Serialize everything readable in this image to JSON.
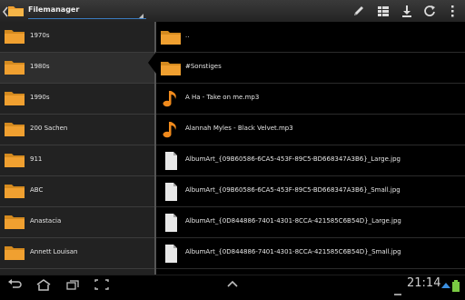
{
  "app": {
    "title": "Filemanager"
  },
  "toolbar": {
    "icons": [
      "edit-pencil-icon",
      "grid-view-icon",
      "download-icon",
      "refresh-icon",
      "overflow-menu-icon"
    ]
  },
  "left_pane": {
    "selected_index": 1,
    "items": [
      {
        "label": "1970s"
      },
      {
        "label": "1980s"
      },
      {
        "label": "1990s"
      },
      {
        "label": "200 Sachen"
      },
      {
        "label": "911"
      },
      {
        "label": "ABC"
      },
      {
        "label": "Anastacia"
      },
      {
        "label": "Annett Louisan"
      }
    ]
  },
  "right_pane": {
    "items": [
      {
        "label": "..",
        "icon": "folder-icon"
      },
      {
        "label": "#Sonstiges",
        "icon": "folder-icon"
      },
      {
        "label": "A Ha - Take on me.mp3",
        "icon": "music-note-icon"
      },
      {
        "label": "Alannah Myles - Black Velvet.mp3",
        "icon": "music-note-icon"
      },
      {
        "label": "AlbumArt_{09B60586-6CA5-453F-89C5-BD668347A3B6}_Large.jpg",
        "icon": "file-icon"
      },
      {
        "label": "AlbumArt_{09B60586-6CA5-453F-89C5-BD668347A3B6}_Small.jpg",
        "icon": "file-icon"
      },
      {
        "label": "AlbumArt_{0D844886-7401-4301-8CCA-421585C6B54D}_Large.jpg",
        "icon": "file-icon"
      },
      {
        "label": "AlbumArt_{0D844886-7401-4301-8CCA-421585C6B54D}_Small.jpg",
        "icon": "file-icon"
      }
    ]
  },
  "system_bar": {
    "time": "21:14"
  },
  "colors": {
    "folder": "#f0a030",
    "music": "#f08a1c",
    "accent": "#3a7bbf"
  }
}
